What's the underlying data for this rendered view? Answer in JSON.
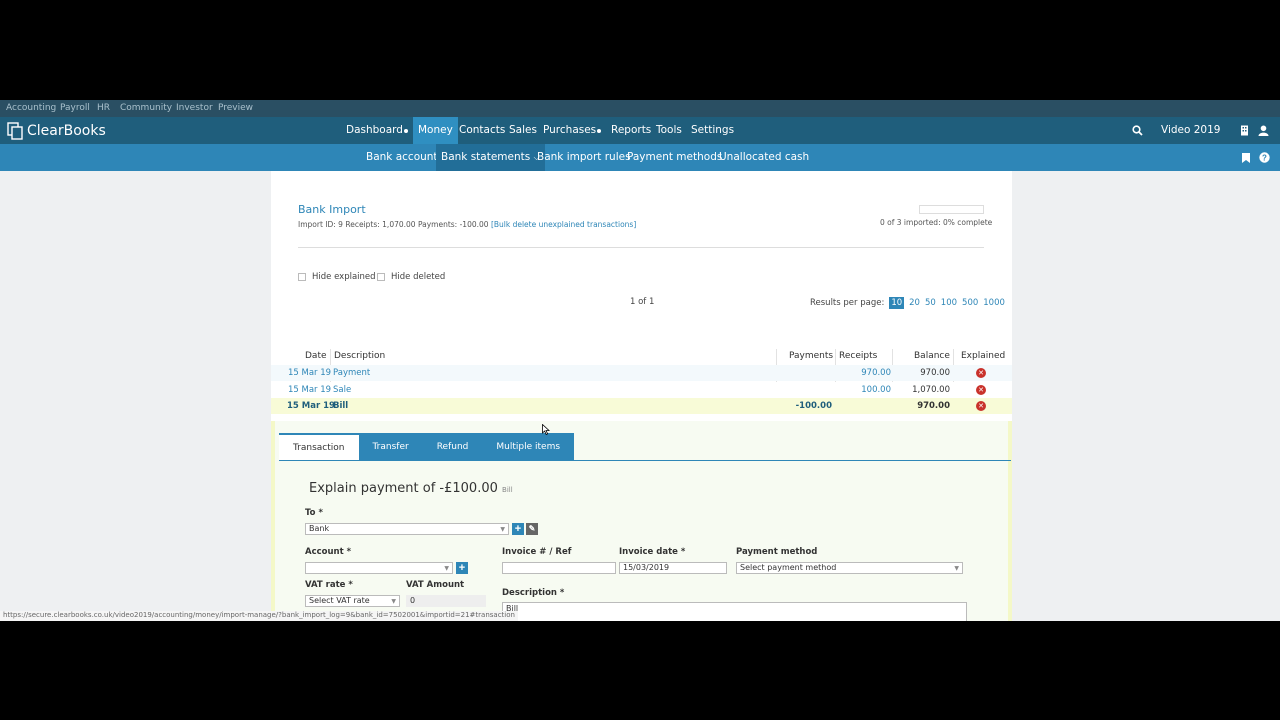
{
  "appbar": {
    "items": [
      "Accounting",
      "Payroll",
      "HR",
      "Community",
      "Investor",
      "Preview"
    ]
  },
  "nav": {
    "logo": "ClearBooks",
    "items": [
      "Dashboard",
      "Money",
      "Contacts",
      "Sales",
      "Purchases",
      "Reports",
      "Tools",
      "Settings"
    ],
    "active": "Money",
    "company": "Video 2019"
  },
  "subnav": {
    "items": [
      "Bank accounts",
      "Bank statements",
      "Bank import rules",
      "Payment methods",
      "Unallocated cash"
    ],
    "active": "Bank statements"
  },
  "import": {
    "title": "Bank Import",
    "meta": "Import ID: 9 Receipts: 1,070.00 Payments: -100.00",
    "bulk_delete": "[Bulk delete unexplained transactions]",
    "progress": "0 of 3 imported: 0% complete",
    "progress_fraction": 0
  },
  "filters": {
    "hide_explained": "Hide explained",
    "hide_deleted": "Hide deleted"
  },
  "pager": {
    "text": "1 of 1",
    "rpp_label": "Results per page:",
    "rpp_options": [
      "10",
      "20",
      "50",
      "100",
      "500",
      "1000"
    ],
    "rpp_selected": "10"
  },
  "table": {
    "headers": [
      "Date",
      "Description",
      "Payments",
      "Receipts",
      "Balance",
      "Explained"
    ],
    "rows": [
      {
        "date": "15 Mar 19",
        "description": "Payment",
        "payments": "",
        "receipts": "970.00",
        "balance": "970.00"
      },
      {
        "date": "15 Mar 19",
        "description": "Sale",
        "payments": "",
        "receipts": "100.00",
        "balance": "1,070.00"
      },
      {
        "date": "15 Mar 19",
        "description": "Bill",
        "payments": "-100.00",
        "receipts": "",
        "balance": "970.00"
      }
    ]
  },
  "explain": {
    "tabs": [
      "Transaction",
      "Transfer",
      "Refund",
      "Multiple items"
    ],
    "active_tab": "Transaction",
    "title": "Explain payment of -£100.00",
    "title_tag": "Bill",
    "to_label": "To *",
    "to_value": "Bank",
    "account_label": "Account *",
    "account_value": "",
    "vat_rate_label": "VAT rate *",
    "vat_rate_value": "Select VAT rate",
    "vat_amount_label": "VAT Amount",
    "vat_amount_value": "0",
    "invoice_ref_label": "Invoice # / Ref",
    "invoice_ref_value": "",
    "invoice_date_label": "Invoice date *",
    "invoice_date_value": "15/03/2019",
    "payment_method_label": "Payment method",
    "payment_method_value": "Select payment method",
    "description_label": "Description *",
    "description_value": "Bill"
  },
  "status_url": "https://secure.clearbooks.co.uk/video2019/accounting/money/import-manage/?bank_import_log=9&bank_id=7502001&importid=21#transaction",
  "colors": {
    "nav": "#1f5e7c",
    "subnav": "#2e86b7",
    "accent": "#2e86b7",
    "error": "#c9322b",
    "highlight_row": "#f8fbd7"
  }
}
